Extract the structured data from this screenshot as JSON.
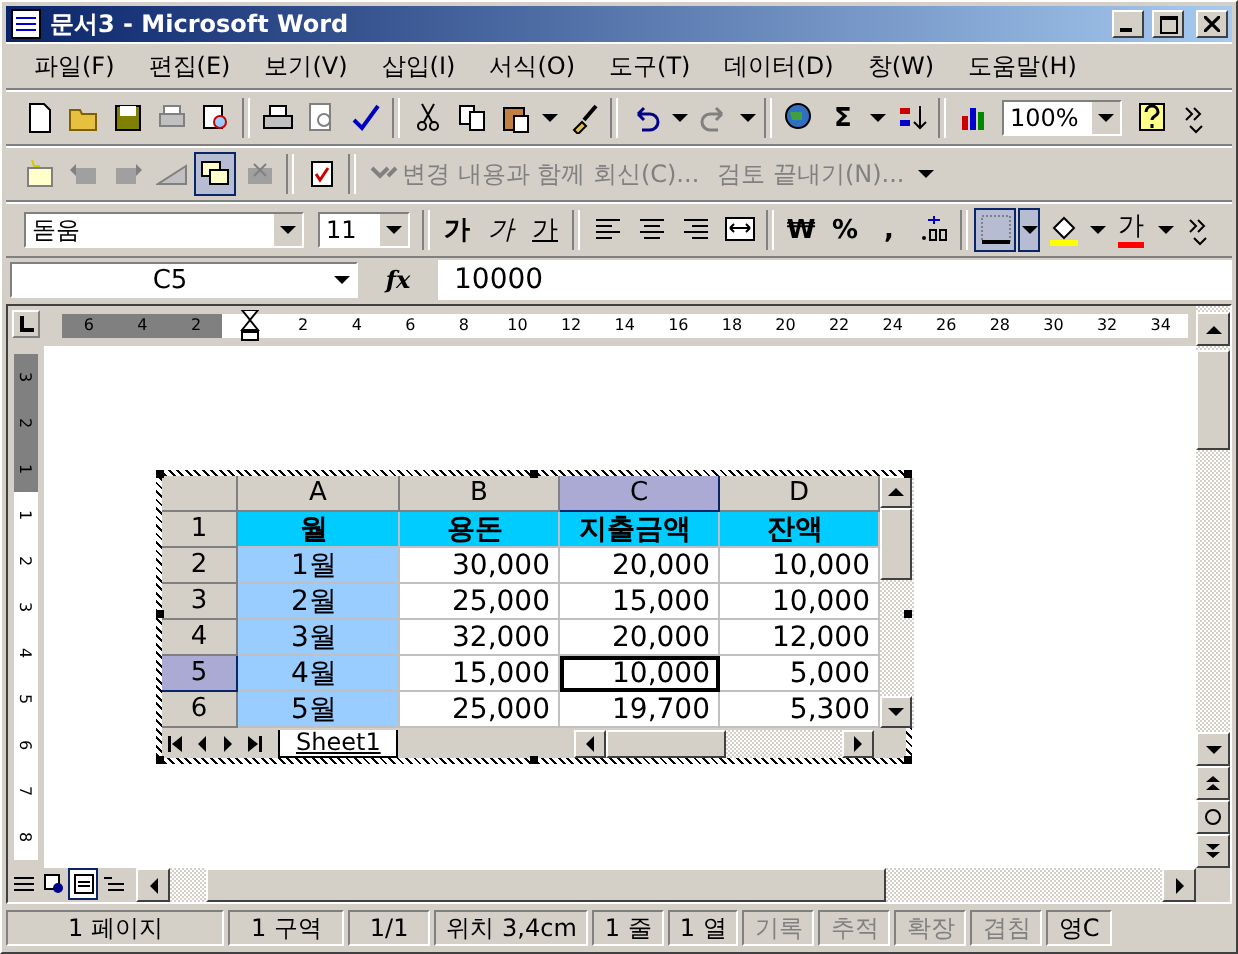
{
  "window": {
    "title": "문서3 - Microsoft Word"
  },
  "menu": [
    "파일(F)",
    "편집(E)",
    "보기(V)",
    "삽입(I)",
    "서식(O)",
    "도구(T)",
    "데이터(D)",
    "창(W)",
    "도움말(H)"
  ],
  "standard_toolbar": {
    "sum": "Σ",
    "zoom": "100%"
  },
  "reviewing_toolbar": {
    "reviewing_pane": {
      "selected": true
    },
    "reply": "변경 내용과 함께 회신(C)...",
    "end_review": "검토 끝내기(N)..."
  },
  "formatting_toolbar": {
    "font": "돋움",
    "size": "11",
    "bold": "가",
    "italic": "가",
    "underline": "가",
    "currency": "₩",
    "percent": "%",
    "comma": ",",
    "borders": {
      "selected": true
    },
    "font_color": "가"
  },
  "formula_bar": {
    "name_box": "C5",
    "fx": "fx",
    "value": "10000"
  },
  "ruler": {
    "left_labels": [
      "6",
      "4",
      "2"
    ],
    "right_labels": [
      "2",
      "4",
      "6",
      "8",
      "10",
      "12",
      "14",
      "16",
      "18",
      "20",
      "22",
      "24",
      "26",
      "28",
      "30",
      "32",
      "34"
    ]
  },
  "vertical_ruler": {
    "top_labels": [
      "3",
      "2",
      "1"
    ],
    "labels": [
      "1",
      "2",
      "3",
      "4",
      "5",
      "6",
      "7",
      "8"
    ]
  },
  "sheet": {
    "columns": [
      {
        "label": "A",
        "selected": false
      },
      {
        "label": "B",
        "selected": false
      },
      {
        "label": "C",
        "selected": true
      },
      {
        "label": "D",
        "selected": false
      }
    ],
    "rows": [
      {
        "header": "1",
        "selected": false,
        "cells": [
          {
            "text": "월",
            "kind": "title"
          },
          {
            "text": "용돈",
            "kind": "title"
          },
          {
            "text": "지출금액",
            "kind": "title"
          },
          {
            "text": "잔액",
            "kind": "title"
          }
        ]
      },
      {
        "header": "2",
        "selected": false,
        "cells": [
          {
            "text": "1월",
            "kind": "selected"
          },
          {
            "text": "30,000",
            "kind": "normal"
          },
          {
            "text": "20,000",
            "kind": "normal"
          },
          {
            "text": "10,000",
            "kind": "normal"
          }
        ]
      },
      {
        "header": "3",
        "selected": false,
        "cells": [
          {
            "text": "2월",
            "kind": "selected"
          },
          {
            "text": "25,000",
            "kind": "normal"
          },
          {
            "text": "15,000",
            "kind": "normal"
          },
          {
            "text": "10,000",
            "kind": "normal"
          }
        ]
      },
      {
        "header": "4",
        "selected": false,
        "cells": [
          {
            "text": "3월",
            "kind": "selected"
          },
          {
            "text": "32,000",
            "kind": "normal"
          },
          {
            "text": "20,000",
            "kind": "normal"
          },
          {
            "text": "12,000",
            "kind": "normal"
          }
        ]
      },
      {
        "header": "5",
        "selected": true,
        "cells": [
          {
            "text": "4월",
            "kind": "selected"
          },
          {
            "text": "15,000",
            "kind": "normal"
          },
          {
            "text": "10,000",
            "kind": "active"
          },
          {
            "text": "5,000",
            "kind": "normal"
          }
        ]
      },
      {
        "header": "6",
        "selected": false,
        "cells": [
          {
            "text": "5월",
            "kind": "selected"
          },
          {
            "text": "25,000",
            "kind": "normal"
          },
          {
            "text": "19,700",
            "kind": "normal"
          },
          {
            "text": "5,300",
            "kind": "normal"
          }
        ]
      }
    ],
    "tab": "Sheet1"
  },
  "view_buttons": [
    {
      "kind": "normal",
      "selected": false
    },
    {
      "kind": "web",
      "selected": false
    },
    {
      "kind": "print",
      "selected": true
    },
    {
      "kind": "outline",
      "selected": false
    }
  ],
  "status_bar": [
    {
      "text": "1 페이지",
      "disabled": false
    },
    {
      "text": "1 구역",
      "disabled": false
    },
    {
      "text": "1/1",
      "disabled": false
    },
    {
      "text": "위치 3,4cm",
      "disabled": false
    },
    {
      "text": "1 줄",
      "disabled": false
    },
    {
      "text": "1 열",
      "disabled": false
    },
    {
      "text": "기록",
      "disabled": true
    },
    {
      "text": "추적",
      "disabled": true
    },
    {
      "text": "확장",
      "disabled": true
    },
    {
      "text": "겹침",
      "disabled": true
    },
    {
      "text": "영C",
      "disabled": false
    }
  ]
}
